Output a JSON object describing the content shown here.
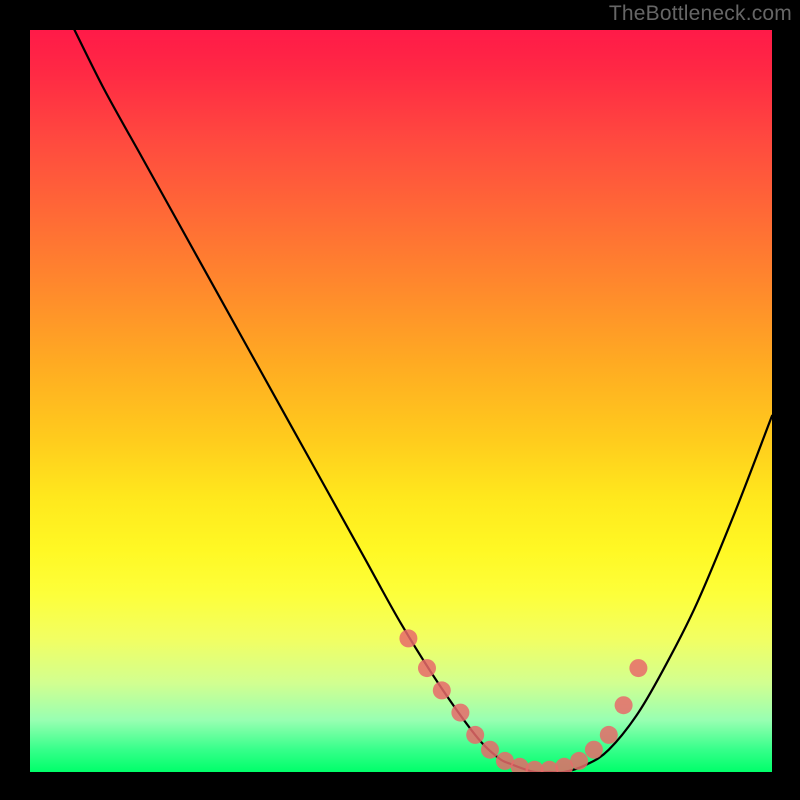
{
  "watermark": "TheBottleneck.com",
  "chart_data": {
    "type": "line",
    "title": "",
    "xlabel": "",
    "ylabel": "",
    "xlim": [
      0,
      100
    ],
    "ylim": [
      0,
      100
    ],
    "grid": false,
    "legend": false,
    "background_gradient": [
      "#ff1a48",
      "#00ff6a"
    ],
    "series": [
      {
        "name": "bottleneck-curve",
        "color": "#000000",
        "x": [
          6,
          10,
          15,
          20,
          25,
          30,
          35,
          40,
          45,
          50,
          55,
          60,
          63,
          65,
          68,
          70,
          72,
          75,
          78,
          82,
          86,
          90,
          95,
          100
        ],
        "y": [
          100,
          92,
          83,
          74,
          65,
          56,
          47,
          38,
          29,
          20,
          12,
          5,
          2,
          1,
          0,
          0,
          0,
          1,
          3,
          8,
          15,
          23,
          35,
          48
        ]
      }
    ],
    "scatter_points": {
      "name": "optimum-markers",
      "color": "#e86a6a",
      "x": [
        51,
        53.5,
        55.5,
        58,
        60,
        62,
        64,
        66,
        68,
        70,
        72,
        74,
        76,
        78,
        80,
        82
      ],
      "y": [
        18,
        14,
        11,
        8,
        5,
        3,
        1.5,
        0.7,
        0.3,
        0.3,
        0.7,
        1.5,
        3,
        5,
        9,
        14
      ]
    }
  }
}
